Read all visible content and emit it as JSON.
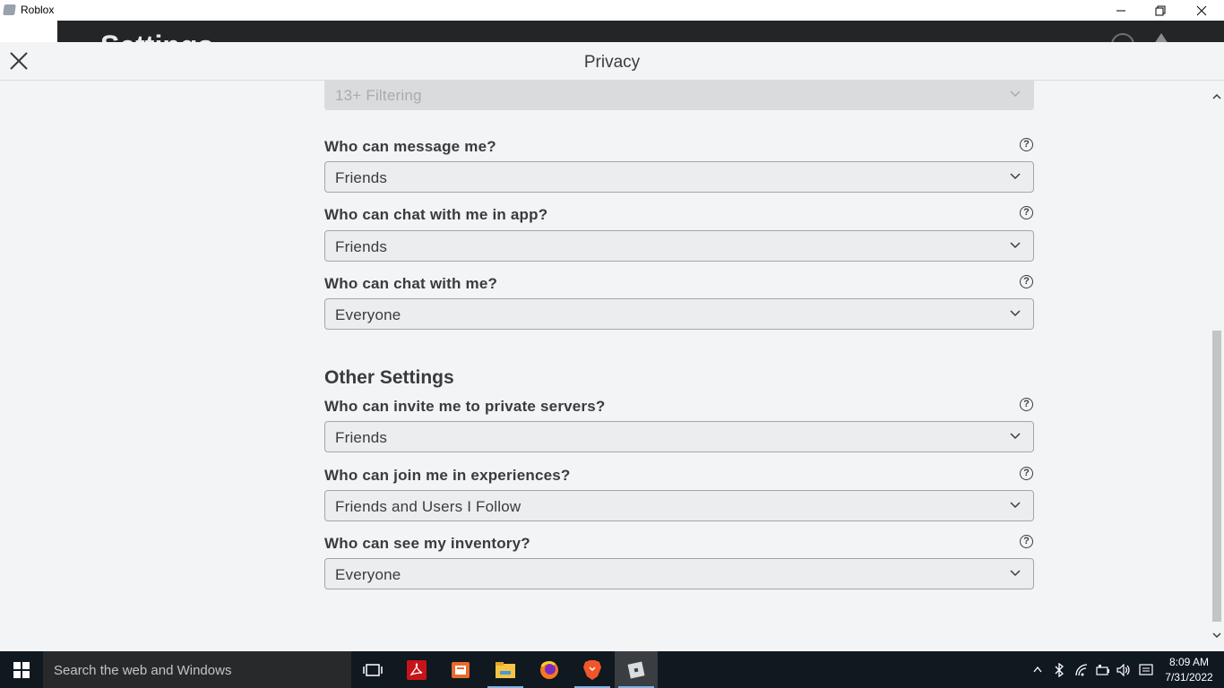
{
  "window": {
    "app_title": "Roblox"
  },
  "background": {
    "heading": "Settings"
  },
  "modal": {
    "title": "Privacy"
  },
  "top_select": {
    "value": "13+ Filtering"
  },
  "questions": [
    {
      "label": "Who can message me?",
      "value": "Friends"
    },
    {
      "label": "Who can chat with me in app?",
      "value": "Friends"
    },
    {
      "label": "Who can chat with me?",
      "value": "Everyone"
    }
  ],
  "other_settings": {
    "title": "Other Settings",
    "questions": [
      {
        "label": "Who can invite me to private servers?",
        "value": "Friends"
      },
      {
        "label": "Who can join me in experiences?",
        "value": "Friends and Users I Follow"
      },
      {
        "label": "Who can see my inventory?",
        "value": "Everyone"
      }
    ]
  },
  "help_glyph": "?",
  "taskbar": {
    "search_placeholder": "Search the web and Windows",
    "apps": [
      "task-view",
      "adobe-acrobat",
      "office",
      "file-explorer",
      "firefox",
      "brave",
      "roblox"
    ],
    "clock_time": "8:09 AM",
    "clock_date": "7/31/2022"
  },
  "colors": {
    "text": "#393b3d",
    "modal_bg": "#f2f4f5",
    "taskbar": "#101820"
  }
}
